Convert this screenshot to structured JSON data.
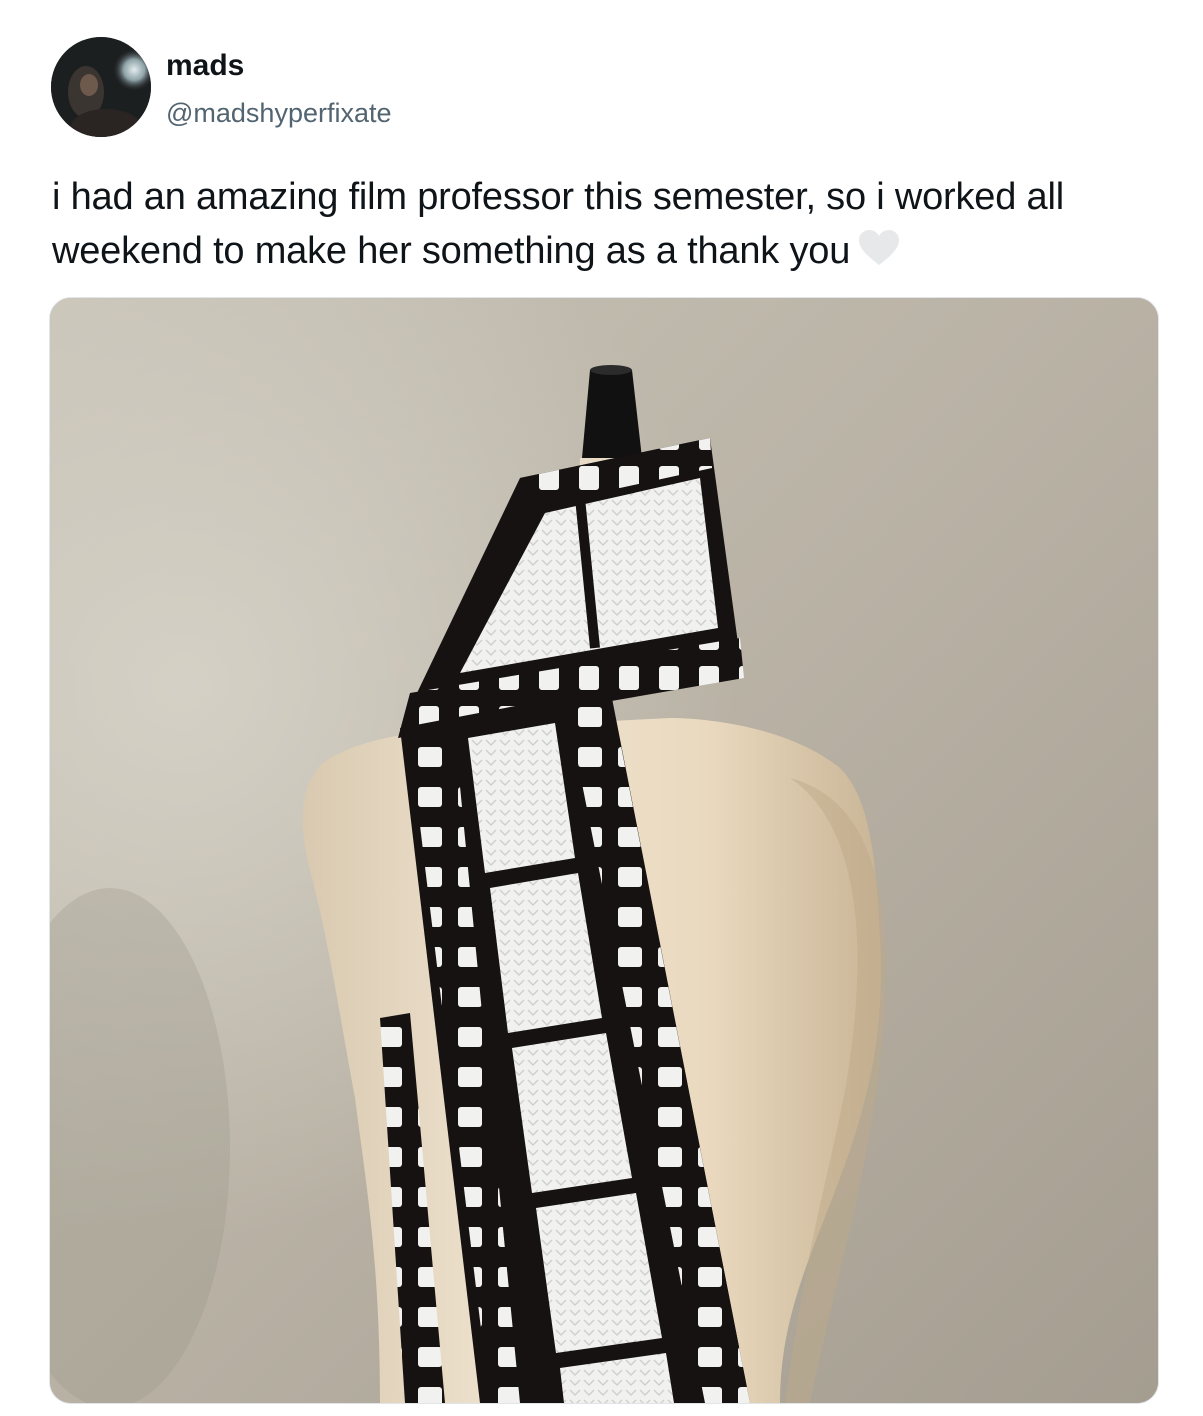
{
  "tweet": {
    "author": {
      "display_name": "mads",
      "handle": "@madshyperfixate",
      "avatar_icon": "profile-avatar"
    },
    "text": "i had an amazing film professor this semester, so i worked all weekend to make her something as a thank you",
    "emoji_icon": "white-heart-icon",
    "media": {
      "type": "photo",
      "icon": "photo-crochet-film-strip-scarf-on-mannequin"
    }
  },
  "colors": {
    "text_primary": "#0f1419",
    "text_secondary": "#536471",
    "background": "#ffffff",
    "heart": "#e6e8ea"
  }
}
